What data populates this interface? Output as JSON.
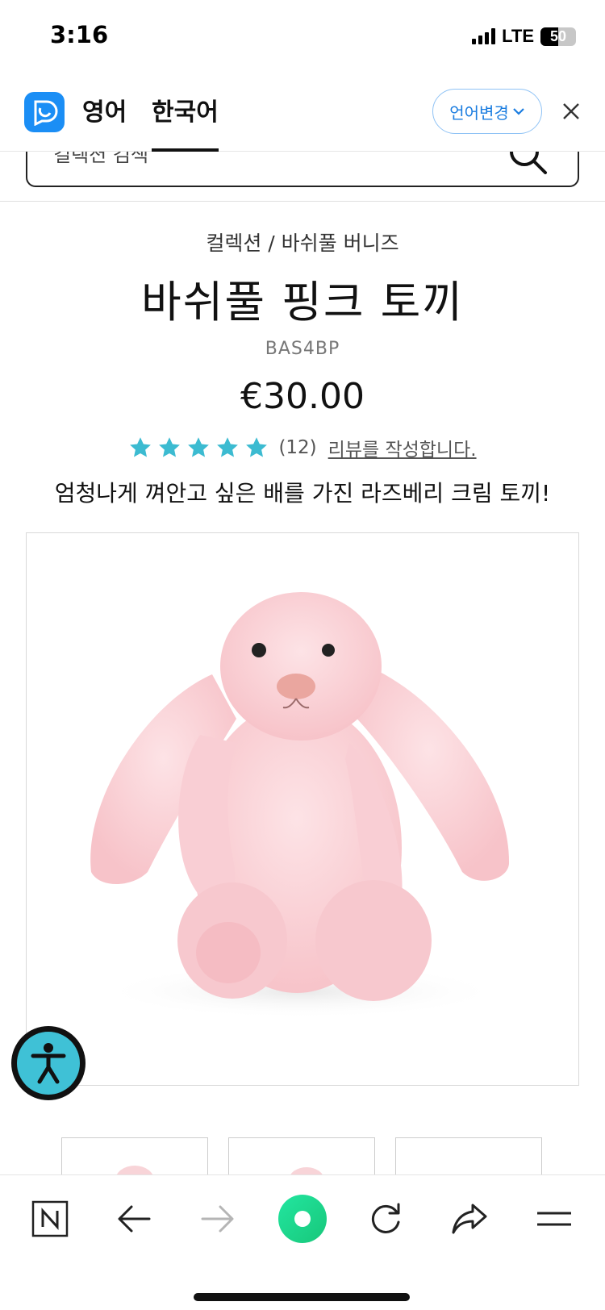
{
  "status_bar": {
    "time": "3:16",
    "network": "LTE",
    "battery": "50",
    "battery_level": 0.5
  },
  "translate_bar": {
    "logo_icon": "papago-logo-icon",
    "tabs": [
      {
        "label": "영어",
        "active": false
      },
      {
        "label": "한국어",
        "active": true
      }
    ],
    "change_language_label": "언어변경",
    "close_icon": "close-icon"
  },
  "search": {
    "placeholder": "컬렉션 검색",
    "icon": "search-icon"
  },
  "product": {
    "breadcrumb": "컬렉션 / 바쉬풀 버니즈",
    "title": "바쉬풀 핑크 토끼",
    "sku": "BAS4BP",
    "price": "€30.00",
    "rating_stars": 5,
    "rating_count": "(12)",
    "review_link": "리뷰를 작성합니다.",
    "tagline": "엄청나게 껴안고 싶은 배를 가진 라즈베리 크림 토끼!",
    "star_color": "#3cbbd1"
  },
  "accessibility_button": {
    "icon": "accessibility-person-icon",
    "color": "#3fc1d6"
  },
  "browser_bar": {
    "buttons": [
      {
        "name": "naver-home-button",
        "icon": "n-logo-icon"
      },
      {
        "name": "back-button",
        "icon": "arrow-left-icon"
      },
      {
        "name": "forward-button",
        "icon": "arrow-right-icon"
      },
      {
        "name": "green-dot-button",
        "icon": "green-dot-icon"
      },
      {
        "name": "reload-button",
        "icon": "reload-icon"
      },
      {
        "name": "share-button",
        "icon": "share-icon"
      },
      {
        "name": "menu-button",
        "icon": "hamburger-icon"
      }
    ],
    "accent": "#1ee58e"
  }
}
